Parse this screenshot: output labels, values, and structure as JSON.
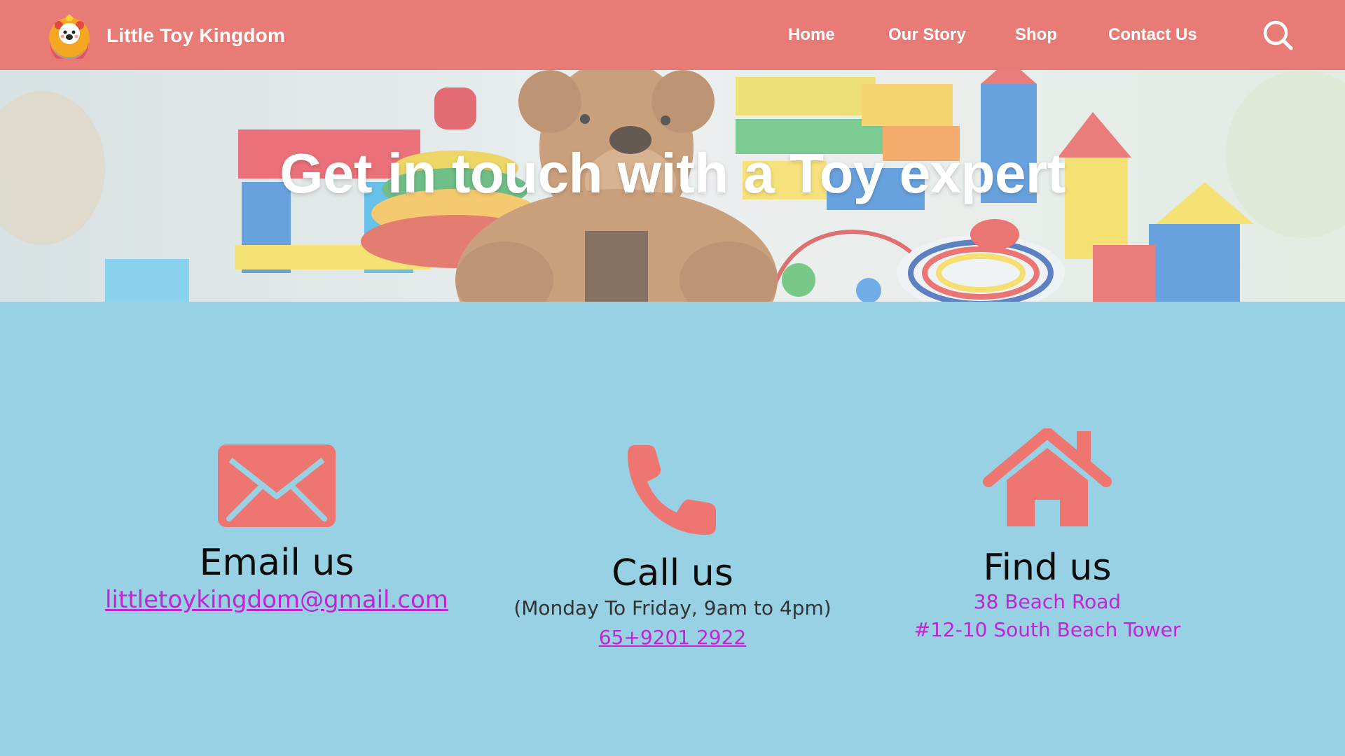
{
  "brand": {
    "name": "Little Toy Kingdom",
    "logo_icon": "bear-mascot-logo"
  },
  "nav": {
    "items": [
      {
        "label": "Home"
      },
      {
        "label": "Our Story"
      },
      {
        "label": "Shop"
      },
      {
        "label": "Contact Us"
      }
    ],
    "search_icon": "search-icon"
  },
  "hero": {
    "title": "Get in touch with a Toy expert"
  },
  "contacts": {
    "email": {
      "icon": "envelope-icon",
      "title": "Email us",
      "address": "littletoykingdom@gmail.com"
    },
    "phone": {
      "icon": "phone-icon",
      "title": "Call us",
      "hours": "(Monday To Friday, 9am to 4pm)",
      "number": "65+9201 2922"
    },
    "location": {
      "icon": "house-icon",
      "title": "Find us",
      "line1": "38 Beach Road",
      "line2": "#12-10 South Beach Tower"
    }
  },
  "colors": {
    "navbar": "#e87b76",
    "background": "#97d1e3",
    "icon": "#ef7570",
    "link": "#c323d6"
  }
}
